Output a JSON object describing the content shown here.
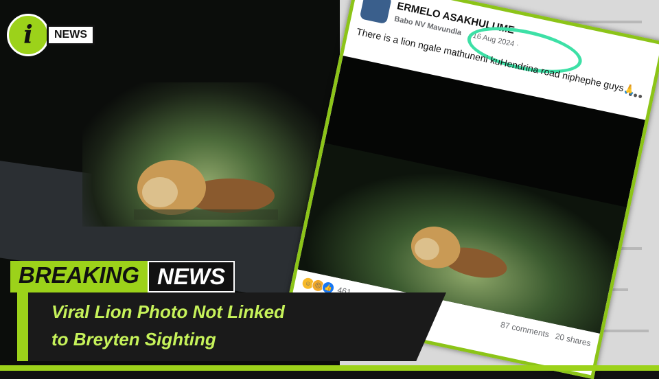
{
  "logo": {
    "letter": "i",
    "wordmark": "NEWS"
  },
  "post": {
    "group_name": "ERMELO ASAKHULUME",
    "author": "Babo NV Mavundla",
    "date": "· 16 Aug 2024 ·",
    "text": "There is a lion ngale mathuneni kuHendrina road niphephe guys🙏",
    "more": "•••",
    "reaction_count": "461",
    "comments": "87 comments",
    "shares": "20 shares"
  },
  "banner": {
    "breaking": "BREAKING",
    "news": "NEWS"
  },
  "headline": {
    "line1": "Viral Lion Photo Not Linked",
    "line2": "to Breyten Sighting"
  },
  "colors": {
    "accent": "#9cd21a",
    "highlight_circle": "#3de0a6",
    "headline_text": "#c6f25a"
  },
  "icons": [
    "logo-mark",
    "avatar",
    "more-options-icon",
    "laugh-reaction-icon",
    "wow-reaction-icon",
    "like-reaction-icon",
    "lion-photo"
  ]
}
